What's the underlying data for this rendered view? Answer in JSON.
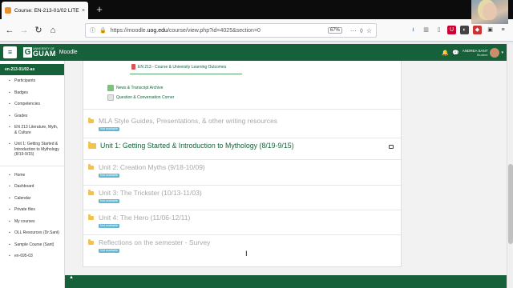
{
  "browser": {
    "tab_title": "Course: EN-213-01/02 LITERATU",
    "tab_close": "×",
    "new_tab": "+",
    "url_prefix": "https://moodle.",
    "url_host": "uog.edu",
    "url_path": "/course/view.php?id=4025&section=0",
    "zoom": "67%",
    "more": "···"
  },
  "header": {
    "brand_small": "UNIVERSITY OF",
    "brand": "GUAM",
    "app": "Moodle",
    "user_name": "ANDREA SANT",
    "user_role": "Student"
  },
  "drawer": {
    "course": "en-213-01/02-as",
    "items": [
      {
        "label": "Participants",
        "icon": "users-icon"
      },
      {
        "label": "Badges",
        "icon": "badge-icon"
      },
      {
        "label": "Competencies",
        "icon": "competency-icon"
      },
      {
        "label": "Grades",
        "icon": "grades-icon"
      },
      {
        "label": "EN 213 Literature, Myth, & Culture",
        "icon": "folder-icon"
      },
      {
        "label": "Unit 1: Getting Started & Introduction to Mythology (8/19-9/15)",
        "icon": "folder-icon"
      }
    ],
    "items2": [
      {
        "label": "Home",
        "icon": "home-icon"
      },
      {
        "label": "Dashboard",
        "icon": "dashboard-icon"
      },
      {
        "label": "Calendar",
        "icon": "calendar-icon"
      },
      {
        "label": "Private files",
        "icon": "file-icon"
      },
      {
        "label": "My courses",
        "icon": "courses-icon"
      },
      {
        "label": "OLL Resources (Dr.Sant)",
        "icon": "course-icon"
      },
      {
        "label": "Sample Course (Sant)",
        "icon": "course-icon"
      },
      {
        "label": "en-695-03",
        "icon": "course-icon"
      }
    ]
  },
  "activities": {
    "outcomes": "EN 213 - Course & University Learning Outcomes",
    "news": "News & Transcript Archive",
    "forum": "Question & Conversation Corner"
  },
  "sections": [
    {
      "title": "MLA Style Guides, Presentations, & other writing resources",
      "badge": "Not available"
    },
    {
      "title": "Unit 1: Getting Started & Introduction to Mythology (8/19-9/15)",
      "badge": ""
    },
    {
      "title": "Unit 2: Creation Myths (9/18-10/09)",
      "badge": "Not available"
    },
    {
      "title": "Unit 3: The Trickster (10/13-11/03)",
      "badge": "Not available"
    },
    {
      "title": "Unit 4: The Hero (11/06-12/11)",
      "badge": "Not available"
    },
    {
      "title": "Reflections on the semester - Survey",
      "badge": "Not available"
    }
  ],
  "colors": {
    "brand_green": "#16613a",
    "badge_blue": "#63b7d4",
    "folder_yellow": "#f3c24b"
  }
}
